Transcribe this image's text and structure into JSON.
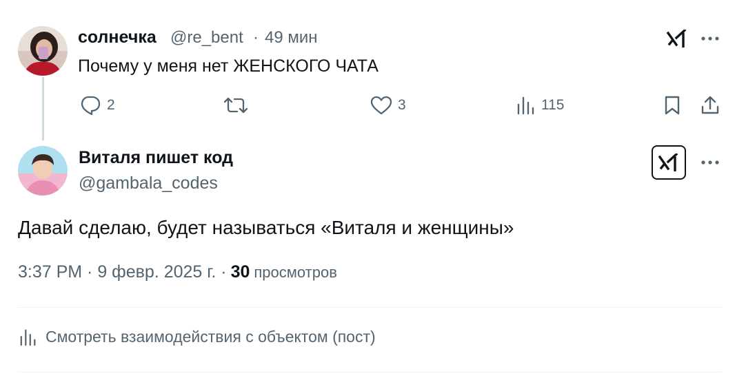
{
  "parent_tweet": {
    "display_name": "солнечка",
    "handle": "@re_bent",
    "separator": "·",
    "time_ago": "49 мин",
    "text": "Почему у меня нет ЖЕНСКОГО ЧАТА",
    "actions": {
      "reply_count": "2",
      "retweet_count": "",
      "like_count": "3",
      "view_count": "115"
    }
  },
  "main_tweet": {
    "display_name": "Виталя пишет код",
    "handle": "@gambala_codes",
    "text": "Давай сделаю, будет называться «Виталя и женщины»",
    "time": "3:37 PM · 9 февр. 2025 г. ·",
    "views_count": "30",
    "views_label": "просмотров"
  },
  "engagement_link": "Смотреть взаимодействия с объектом (пост)",
  "icons": {
    "grok": "grok-icon",
    "more": "more-icon",
    "reply": "reply-icon",
    "retweet": "retweet-icon",
    "like": "heart-icon",
    "views": "views-icon",
    "bookmark": "bookmark-icon",
    "share": "share-icon"
  },
  "colors": {
    "text_primary": "#0f1419",
    "text_secondary": "#536471",
    "divider": "#eff3f4",
    "thread_line": "#cfd9de"
  }
}
